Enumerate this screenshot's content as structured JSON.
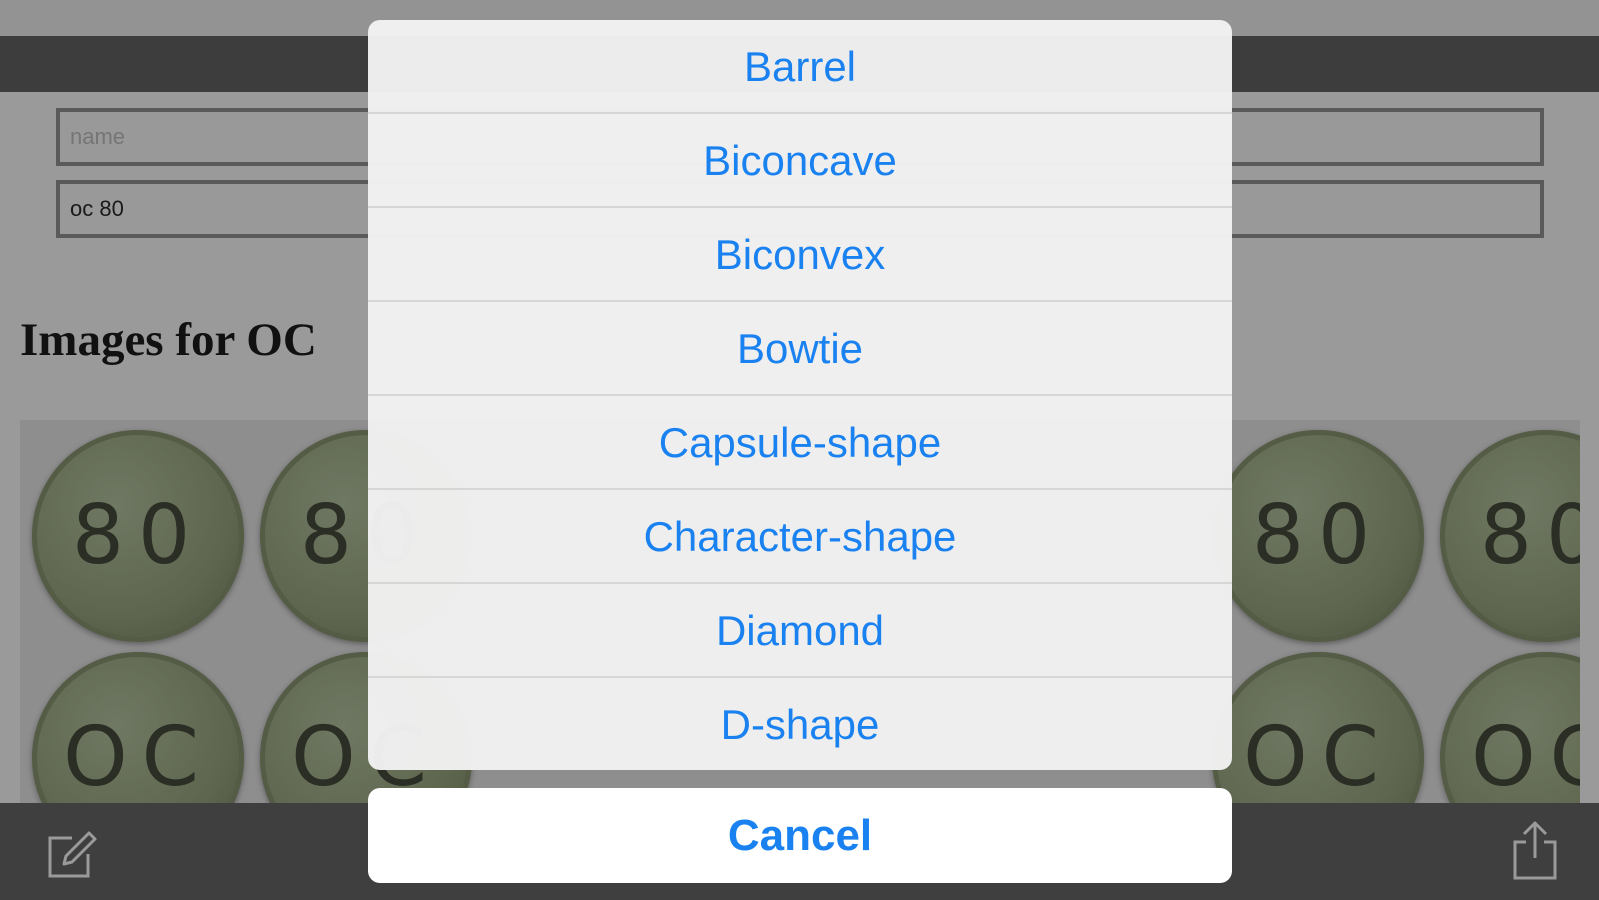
{
  "form": {
    "name_placeholder": "name",
    "code_value": "oc 80"
  },
  "section": {
    "heading": "Images for OC"
  },
  "images": {
    "pill_imprints_top": [
      "80",
      "80",
      "80",
      "80"
    ],
    "pill_imprints_bottom": [
      "OC",
      "OC",
      "OC",
      "OC"
    ]
  },
  "action_sheet": {
    "options": [
      "Barrel",
      "Biconcave",
      "Biconvex",
      "Bowtie",
      "Capsule-shape",
      "Character-shape",
      "Diamond",
      "D-shape"
    ],
    "cancel_label": "Cancel"
  },
  "toolbar": {
    "left_icon": "compose-icon",
    "right_icon": "share-icon"
  },
  "colors": {
    "accent": "#1a82f0",
    "toolbar_bg": "#3f3f3f",
    "header_bar": "#3d3d3d"
  }
}
